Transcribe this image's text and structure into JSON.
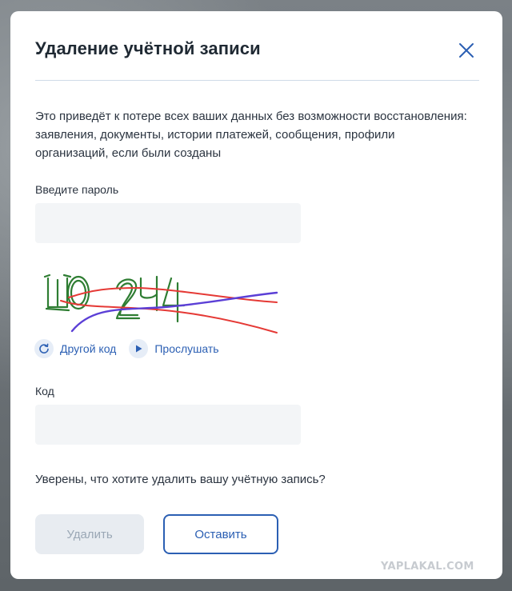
{
  "dialog": {
    "title": "Удаление учётной записи",
    "warning": "Это приведёт к потере всех ваших данных без возможности восстановления: заявления, документы, истории платежей, сообщения, профили организаций, если были созданы",
    "close_icon": "close-icon"
  },
  "password": {
    "label": "Введите пароль",
    "value": "",
    "placeholder": ""
  },
  "captcha": {
    "text": "Ш02Ч4",
    "refresh_label": "Другой код",
    "refresh_icon": "refresh-icon",
    "listen_label": "Прослушать",
    "listen_icon": "play-icon"
  },
  "code": {
    "label": "Код",
    "value": "",
    "placeholder": ""
  },
  "confirm_text": "Уверены, что хотите удалить вашу учётную запись?",
  "buttons": {
    "delete": "Удалить",
    "keep": "Оставить"
  },
  "watermark": "YAPLAKAL.COM",
  "colors": {
    "accent": "#2b5fb3",
    "disabled_bg": "#e8ecf1",
    "disabled_text": "#9aa7b5",
    "input_bg": "#f3f5f7",
    "captcha_green": "#2e7d32",
    "captcha_red": "#e53935",
    "captcha_purple": "#5b3fd6"
  }
}
